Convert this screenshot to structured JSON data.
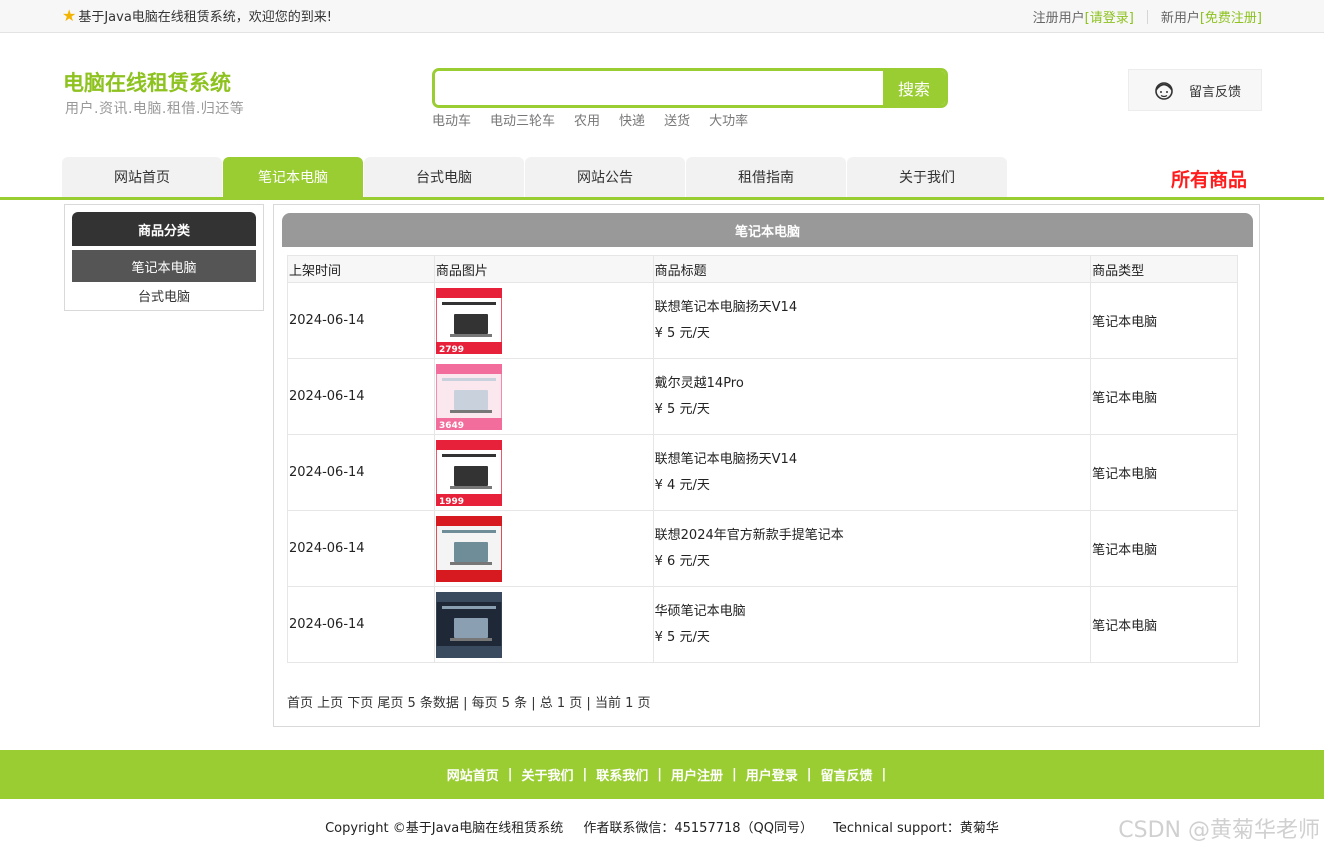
{
  "topbar": {
    "welcome": "基于Java电脑在线租赁系统，欢迎您的到来!",
    "register_user_label": "注册用户",
    "login_link": "[请登录]",
    "new_user_label": "新用户",
    "signup_link": "[免费注册]"
  },
  "header": {
    "site_title": "电脑在线租赁系统",
    "site_subtitle": "用户.资讯.电脑.租借.归还等",
    "search_button": "搜索",
    "search_value": "",
    "hot_words": [
      "电动车",
      "电动三轮车",
      "农用",
      "快递",
      "送货",
      "大功率"
    ],
    "feedback_label": "留言反馈"
  },
  "nav": {
    "tabs": [
      "网站首页",
      "笔记本电脑",
      "台式电脑",
      "网站公告",
      "租借指南",
      "关于我们"
    ],
    "active_index": 1,
    "all_goods": "所有商品"
  },
  "sidebar": {
    "title": "商品分类",
    "items": [
      "笔记本电脑",
      "台式电脑"
    ]
  },
  "main": {
    "panel_title": "笔记本电脑",
    "columns": [
      "上架时间",
      "商品图片",
      "商品标题",
      "商品类型"
    ],
    "rows": [
      {
        "date": "2024-06-14",
        "title": "联想笔记本电脑扬天V14",
        "price": "¥ 5 元/天",
        "type": "笔记本电脑",
        "thumb_style": "red",
        "thumb_text": "2799"
      },
      {
        "date": "2024-06-14",
        "title": "戴尔灵越14Pro",
        "price": "¥ 5 元/天",
        "type": "笔记本电脑",
        "thumb_style": "pink",
        "thumb_text": "3649"
      },
      {
        "date": "2024-06-14",
        "title": "联想笔记本电脑扬天V14",
        "price": "¥ 4 元/天",
        "type": "笔记本电脑",
        "thumb_style": "red",
        "thumb_text": "1999"
      },
      {
        "date": "2024-06-14",
        "title": "联想2024年官方新款手提笔记本",
        "price": "¥ 6 元/天",
        "type": "笔记本电脑",
        "thumb_style": "light",
        "thumb_text": ""
      },
      {
        "date": "2024-06-14",
        "title": "华硕笔记本电脑",
        "price": "¥ 5 元/天",
        "type": "笔记本电脑",
        "thumb_style": "dark",
        "thumb_text": ""
      }
    ],
    "pager": "首页 上页 下页 尾页 5 条数据 | 每页 5 条 | 总 1 页 | 当前 1 页"
  },
  "footer": {
    "links": [
      "网站首页",
      "关于我们",
      "联系我们",
      "用户注册",
      "用户登录",
      "留言反馈"
    ],
    "copyright": "Copyright ©基于Java电脑在线租赁系统",
    "contact": "作者联系微信：45157718（QQ同号）",
    "support": "Technical support：黄菊华",
    "watermark": "CSDN @黄菊华老师"
  },
  "colors": {
    "accent": "#9acd32",
    "title_green": "#8dc21f",
    "highlight_red": "#ff1c1c",
    "dark": "#333333"
  }
}
